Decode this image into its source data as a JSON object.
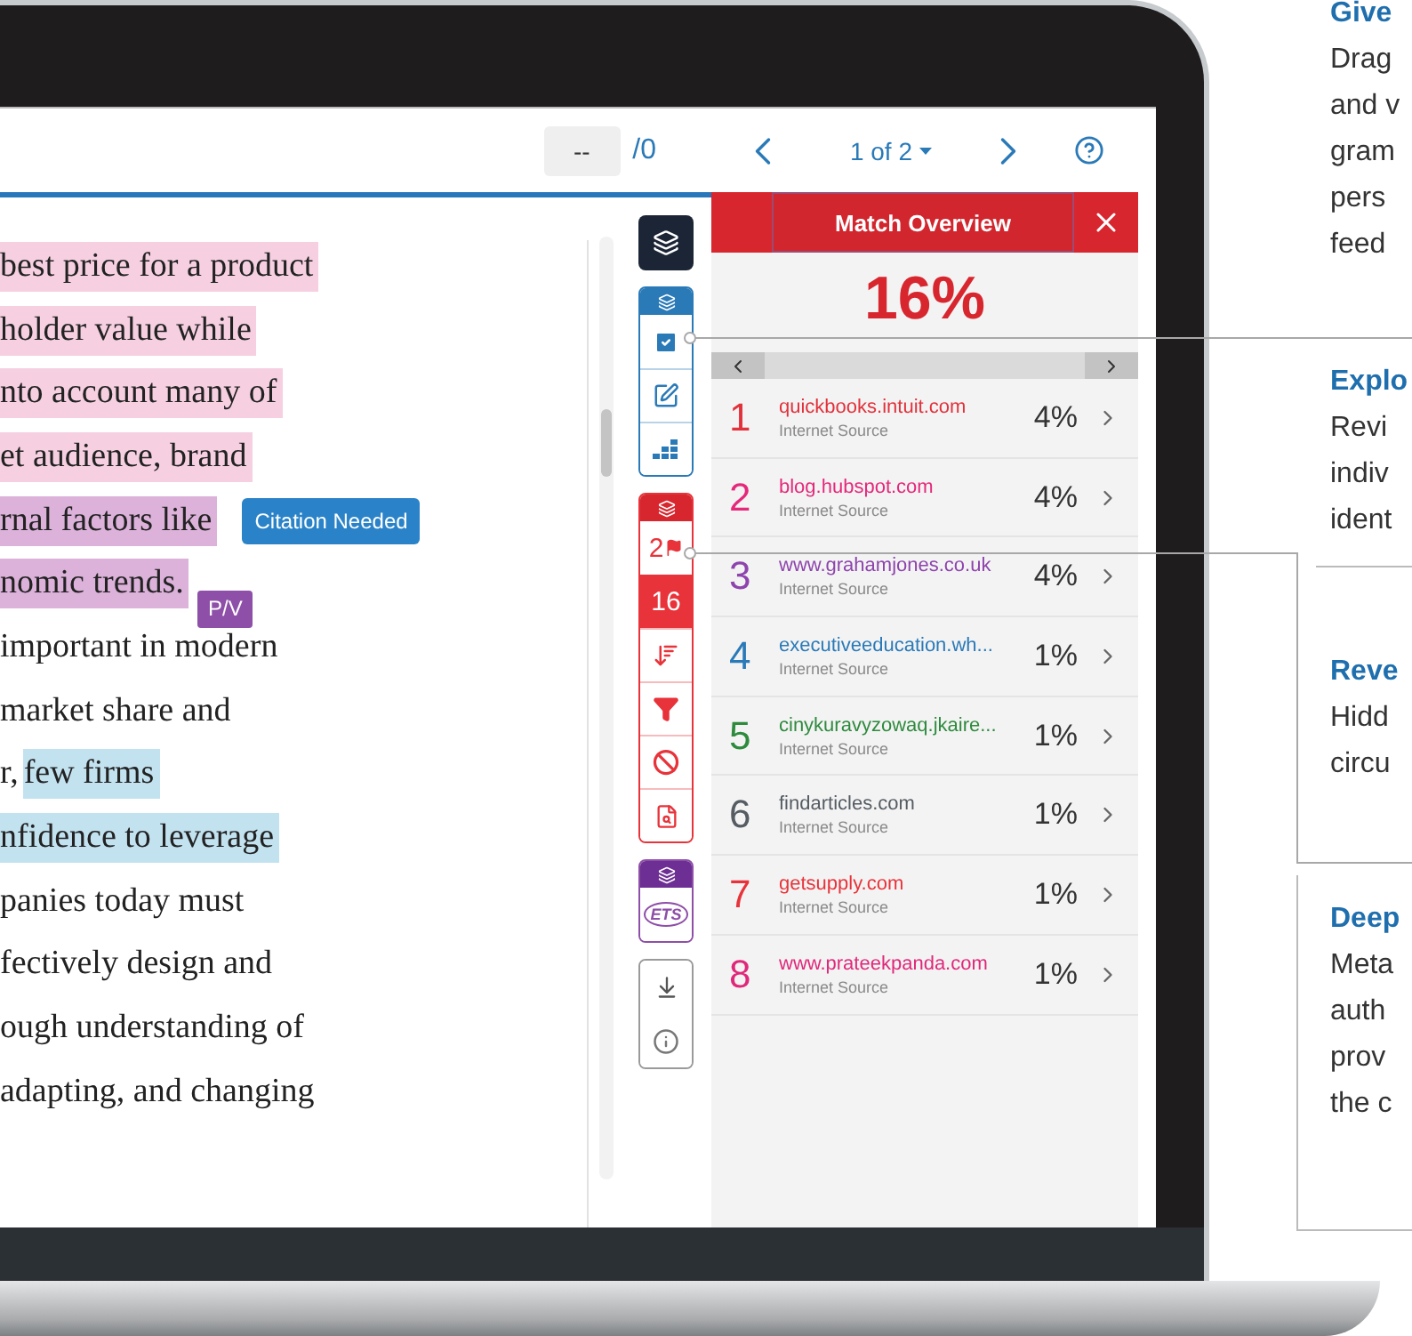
{
  "toolbar": {
    "page_field": {
      "value": "--"
    },
    "page_total": "/0",
    "pager": "1 of 2"
  },
  "document": {
    "lines": [
      {
        "segments": [
          {
            "text": "best price for a product",
            "color": "#f6d0e1"
          }
        ]
      },
      {
        "segments": [
          {
            "text": "holder value while",
            "color": "#f6d0e1"
          }
        ]
      },
      {
        "segments": [
          {
            "text": "nto account many of",
            "color": "#f6d0e1"
          }
        ]
      },
      {
        "segments": [
          {
            "text": "et audience, brand",
            "color": "#f6d0e1"
          }
        ]
      },
      {
        "segments": [
          {
            "text": "rnal factors like",
            "color": "#dcb2db"
          }
        ],
        "tag": "Citation Needed"
      },
      {
        "segments": [
          {
            "text": "nomic trends.",
            "color": "#dcb2db"
          }
        ],
        "note": "P/V"
      },
      {
        "segments": [
          {
            "text": "important in modern"
          }
        ]
      },
      {
        "segments": [
          {
            "text": "market share and"
          }
        ]
      },
      {
        "segments": [
          {
            "text": "r, "
          },
          {
            "text": "few firms",
            "color": "#c3e2f0"
          }
        ]
      },
      {
        "segments": [
          {
            "text": "nfidence to leverage",
            "color": "#c3e2f0"
          }
        ]
      },
      {
        "segments": [
          {
            "text": "panies today must"
          }
        ]
      },
      {
        "segments": [
          {
            "text": "fectively design and"
          }
        ]
      },
      {
        "segments": [
          {
            "text": "ough understanding of"
          }
        ]
      },
      {
        "segments": [
          {
            "text": "adapting, and changing"
          }
        ]
      }
    ]
  },
  "side_toolbar": {
    "flag_count": "2",
    "match_count": "16",
    "ets_label": "ETS"
  },
  "match_overview": {
    "title": "Match Overview",
    "score": "16%",
    "sources": [
      {
        "number": "1",
        "site": "quickbooks.intuit.com",
        "type": "Internet Source",
        "percent": "4%",
        "color": "#e2313b"
      },
      {
        "number": "2",
        "site": "blog.hubspot.com",
        "type": "Internet Source",
        "percent": "4%",
        "color": "#e5287a"
      },
      {
        "number": "3",
        "site": "www.grahamjones.co.uk",
        "type": "Internet Source",
        "percent": "4%",
        "color": "#8e44ad"
      },
      {
        "number": "4",
        "site": "executiveeducation.wh...",
        "type": "Internet Source",
        "percent": "1%",
        "color": "#2a7ab8"
      },
      {
        "number": "5",
        "site": "cinykuravyzowaq.jkaire...",
        "type": "Internet Source",
        "percent": "1%",
        "color": "#2e8b3e"
      },
      {
        "number": "6",
        "site": "findarticles.com",
        "type": "Internet Source",
        "percent": "1%",
        "color": "#555c63"
      },
      {
        "number": "7",
        "site": "getsupply.com",
        "type": "Internet Source",
        "percent": "1%",
        "color": "#e8333a"
      },
      {
        "number": "8",
        "site": "www.prateekpanda.com",
        "type": "Internet Source",
        "percent": "1%",
        "color": "#e0287a"
      }
    ]
  },
  "callouts": [
    {
      "title": "Give",
      "lines": [
        "Drag",
        "and v",
        "gram",
        "pers",
        "feed"
      ]
    },
    {
      "title": "Explo",
      "lines": [
        "Revi",
        "indiv",
        "ident"
      ]
    },
    {
      "title": "Reve",
      "lines": [
        "Hidd",
        "circu"
      ]
    },
    {
      "title": "Deep",
      "lines": [
        "Meta",
        "auth",
        "prov",
        "the c"
      ]
    }
  ]
}
